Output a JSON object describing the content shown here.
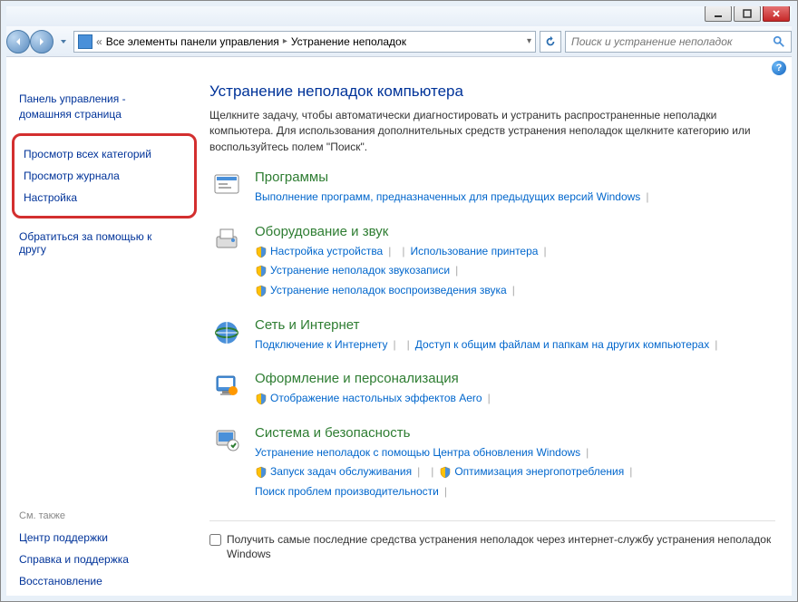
{
  "titlebar": {},
  "breadcrumb": {
    "back_chevron": "«",
    "item1": "Все элементы панели управления",
    "item2": "Устранение неполадок"
  },
  "search": {
    "placeholder": "Поиск и устранение неполадок"
  },
  "sidebar": {
    "home_line1": "Панель управления -",
    "home_line2": "домашняя страница",
    "highlighted": [
      "Просмотр всех категорий",
      "Просмотр журнала",
      "Настройка"
    ],
    "contact1": "Обратиться за помощью к",
    "contact2": "другу",
    "see_also_label": "См. также",
    "see_also": [
      "Центр поддержки",
      "Справка и поддержка",
      "Восстановление"
    ]
  },
  "main": {
    "title": "Устранение неполадок компьютера",
    "description": "Щелкните задачу, чтобы автоматически диагностировать и устранить распространенные неполадки компьютера. Для использования дополнительных средств устранения неполадок щелкните категорию или воспользуйтесь полем \"Поиск\".",
    "categories": [
      {
        "title": "Программы",
        "links": [
          {
            "text": "Выполнение программ, предназначенных для предыдущих версий Windows",
            "shield": false
          }
        ]
      },
      {
        "title": "Оборудование и звук",
        "links": [
          {
            "text": "Настройка устройства",
            "shield": true
          },
          {
            "text": "Использование принтера",
            "shield": false
          },
          {
            "text": "Устранение неполадок звукозаписи",
            "shield": true,
            "break": true
          },
          {
            "text": "Устранение неполадок воспроизведения звука",
            "shield": true,
            "break": true
          }
        ]
      },
      {
        "title": "Сеть и Интернет",
        "links": [
          {
            "text": "Подключение к Интернету",
            "shield": false
          },
          {
            "text": "Доступ к общим файлам и папкам на других компьютерах",
            "shield": false
          }
        ]
      },
      {
        "title": "Оформление и персонализация",
        "links": [
          {
            "text": "Отображение настольных эффектов Aero",
            "shield": true
          }
        ]
      },
      {
        "title": "Система и безопасность",
        "links": [
          {
            "text": "Устранение неполадок с помощью Центра обновления Windows",
            "shield": false
          },
          {
            "text": "Запуск задач обслуживания",
            "shield": true,
            "break": true
          },
          {
            "text": "Оптимизация энергопотребления",
            "shield": true
          },
          {
            "text": "Поиск проблем производительности",
            "shield": false,
            "break": true
          }
        ]
      }
    ],
    "footer_checkbox": "Получить самые последние средства устранения неполадок через интернет-службу устранения неполадок Windows"
  }
}
